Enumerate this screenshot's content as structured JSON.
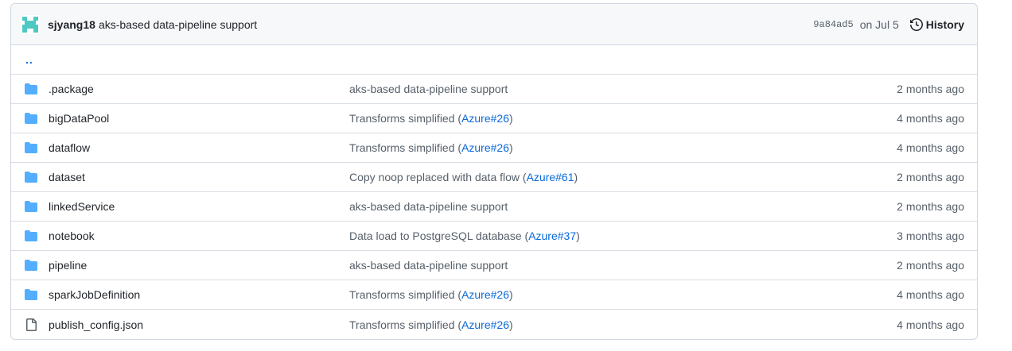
{
  "header": {
    "author": "sjyang18",
    "message": "aks-based data-pipeline support",
    "sha": "9a84ad5",
    "date": "on Jul 5",
    "history_label": "History"
  },
  "parent_dir": "..",
  "files": [
    {
      "name": ".package",
      "type": "folder",
      "msg_before": "aks-based data-pipeline support",
      "msg_link": "",
      "msg_after": "",
      "age": "2 months ago"
    },
    {
      "name": "bigDataPool",
      "type": "folder",
      "msg_before": "Transforms simplified (",
      "msg_link": "Azure#26",
      "msg_after": ")",
      "age": "4 months ago"
    },
    {
      "name": "dataflow",
      "type": "folder",
      "msg_before": "Transforms simplified (",
      "msg_link": "Azure#26",
      "msg_after": ")",
      "age": "4 months ago"
    },
    {
      "name": "dataset",
      "type": "folder",
      "msg_before": "Copy noop replaced with data flow (",
      "msg_link": "Azure#61",
      "msg_after": ")",
      "age": "2 months ago"
    },
    {
      "name": "linkedService",
      "type": "folder",
      "msg_before": "aks-based data-pipeline support",
      "msg_link": "",
      "msg_after": "",
      "age": "2 months ago"
    },
    {
      "name": "notebook",
      "type": "folder",
      "msg_before": "Data load to PostgreSQL database (",
      "msg_link": "Azure#37",
      "msg_after": ")",
      "age": "3 months ago"
    },
    {
      "name": "pipeline",
      "type": "folder",
      "msg_before": "aks-based data-pipeline support",
      "msg_link": "",
      "msg_after": "",
      "age": "2 months ago"
    },
    {
      "name": "sparkJobDefinition",
      "type": "folder",
      "msg_before": "Transforms simplified (",
      "msg_link": "Azure#26",
      "msg_after": ")",
      "age": "4 months ago"
    },
    {
      "name": "publish_config.json",
      "type": "file",
      "msg_before": "Transforms simplified (",
      "msg_link": "Azure#26",
      "msg_after": ")",
      "age": "4 months ago"
    }
  ],
  "colors": {
    "folder": "#54aeff",
    "link": "#0969da",
    "muted": "#57606a",
    "border": "#d0d7de",
    "header_bg": "#f6f8fa",
    "avatar": "#4ec9c2"
  }
}
